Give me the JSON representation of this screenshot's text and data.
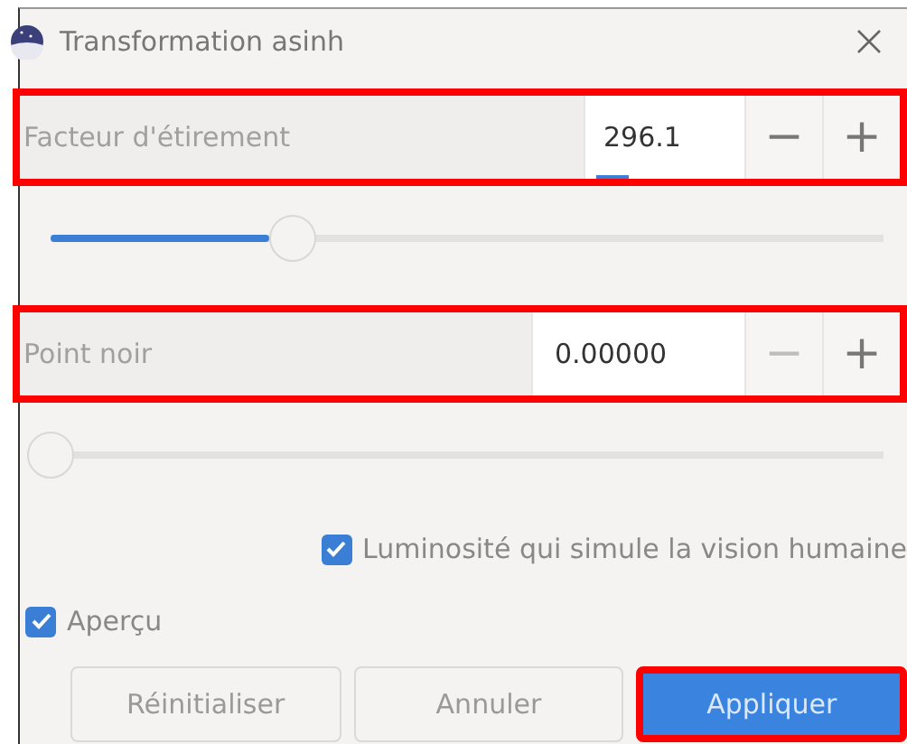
{
  "window": {
    "title": "Transformation asinh"
  },
  "params": [
    {
      "label": "Facteur d'étirement",
      "value": "296.1",
      "minus": "−",
      "plus": "+",
      "minus_disabled": false,
      "level": 0.29,
      "highlighted": true,
      "focused": true
    },
    {
      "label": "Point noir",
      "value": "0.00000",
      "minus": "−",
      "plus": "+",
      "minus_disabled": true,
      "level": 0,
      "highlighted": true,
      "focused": false
    }
  ],
  "options": [
    {
      "label": "Luminosité qui simule la vision humaine",
      "checked": true
    },
    {
      "label": "Aperçu",
      "checked": true
    }
  ],
  "buttons": [
    {
      "label": "Réinitialiser",
      "kind": "secondary",
      "highlighted": false
    },
    {
      "label": "Annuler",
      "kind": "secondary",
      "highlighted": false
    },
    {
      "label": "Appliquer",
      "kind": "primary",
      "highlighted": true
    }
  ]
}
